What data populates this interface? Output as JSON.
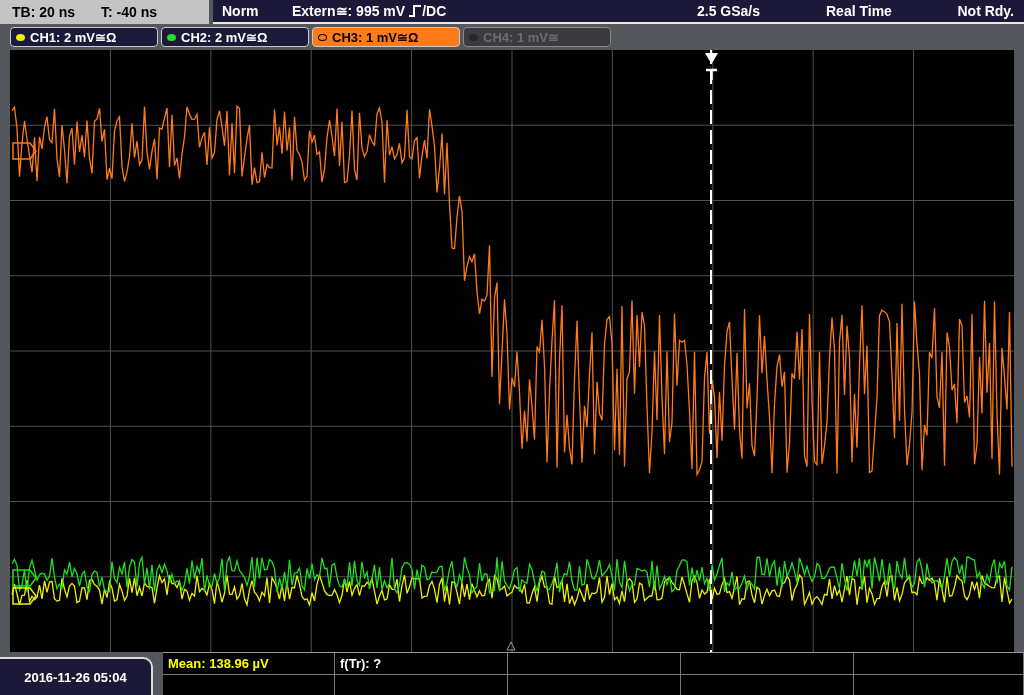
{
  "header": {
    "timebase": "TB: 20 ns",
    "trigger_time": "T: -40 ns",
    "mode": "Norm",
    "trigger_level": "Extern≅: 995 mV",
    "coupling": "/DC",
    "sample_rate": "2.5 GSa/s",
    "acquisition": "Real Time",
    "status": "Not Rdy."
  },
  "channels": [
    {
      "label": "CH1: 2 mV≅Ω",
      "color": "#f0f000",
      "selected": false,
      "disabled": false
    },
    {
      "label": "CH2: 2 mV≅Ω",
      "color": "#20e020",
      "selected": false,
      "disabled": false
    },
    {
      "label": "CH3: 1 mV≅Ω",
      "color": "#ff7a1a",
      "selected": true,
      "disabled": false
    },
    {
      "label": "CH4: 1 mV≅",
      "color": "#262626",
      "selected": false,
      "disabled": true
    }
  ],
  "measurements": [
    {
      "label": "Mean: 138.96 µV",
      "color": "#ffff00"
    },
    {
      "label": "f(Tr): ?",
      "color": "#ffffff"
    }
  ],
  "date": "2016-11-26 05:04"
}
